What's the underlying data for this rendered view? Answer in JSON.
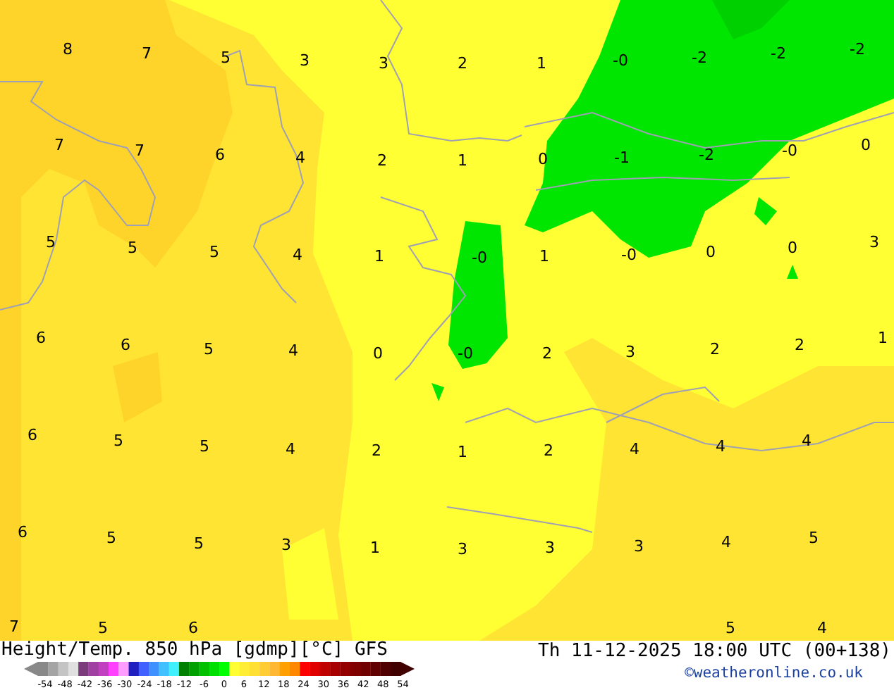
{
  "map": {
    "labels": [
      "8",
      "7",
      "5",
      "3",
      "3",
      "2",
      "1",
      "-0",
      "-2",
      "-2",
      "-2",
      "7",
      "7",
      "6",
      "4",
      "2",
      "1",
      "0",
      "-1",
      "-2",
      "-0",
      "0",
      "5",
      "5",
      "5",
      "4",
      "1",
      "-0",
      "1",
      "-0",
      "0",
      "0",
      "3",
      "6",
      "6",
      "5",
      "4",
      "0",
      "-0",
      "2",
      "3",
      "2",
      "2",
      "1",
      "6",
      "5",
      "5",
      "4",
      "2",
      "1",
      "2",
      "4",
      "4",
      "4",
      "6",
      "5",
      "5",
      "3",
      "1",
      "3",
      "3",
      "3",
      "4",
      "5",
      "7",
      "5",
      "6",
      "5",
      "4"
    ]
  },
  "footer": {
    "title": "Height/Temp. 850 hPa [gdmp][°C] GFS",
    "timestamp": "Th 11-12-2025 18:00 UTC (00+138)",
    "credit_link": "©weatheronline.co.uk"
  },
  "legend": {
    "ticks": [
      "-54",
      "-48",
      "-42",
      "-36",
      "-30",
      "-24",
      "-18",
      "-12",
      "-6",
      "0",
      "6",
      "12",
      "18",
      "24",
      "30",
      "36",
      "42",
      "48",
      "54"
    ]
  }
}
